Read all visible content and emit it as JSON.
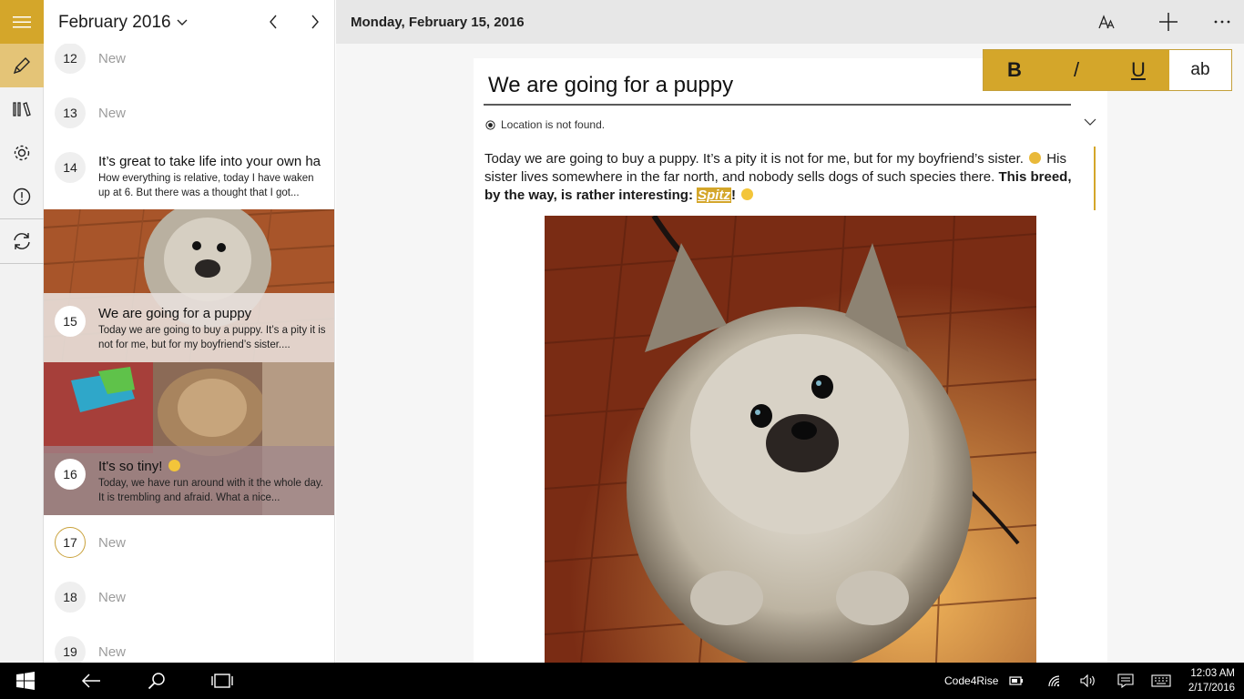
{
  "header": {
    "month": "February 2016",
    "date": "Monday, February 15, 2016"
  },
  "list": {
    "days": [
      {
        "day": "12",
        "label": "New"
      },
      {
        "day": "13",
        "label": "New"
      },
      {
        "day": "14",
        "title": "It’s great to take life into your own ha",
        "body": "How everything is relative, today I have waken up at 6. But there was a thought that I got..."
      },
      {
        "day": "15",
        "title": "We are going for a puppy",
        "body": "Today we are going to buy a puppy. It’s a pity it is not for me, but for my boyfriend’s sister...."
      },
      {
        "day": "16",
        "title": "It's so tiny!",
        "body": "Today, we have run around with it the whole day. It is trembling and afraid. What a nice..."
      },
      {
        "day": "17",
        "label": "New"
      },
      {
        "day": "18",
        "label": "New"
      },
      {
        "day": "19",
        "label": "New"
      }
    ]
  },
  "entry": {
    "title": "We are going for a puppy",
    "location": "Location is not found.",
    "text_1": "Today we are going to buy a puppy. It’s a pity it is not for me, but for my boyfriend’s sister.",
    "text_2": " His sister lives somewhere in the far north, and nobody sells dogs of such species there. ",
    "text_bold": "This breed, by the way, is rather interesting: ",
    "highlight": "Spitz",
    "text_end": "!"
  },
  "format": {
    "bold": "B",
    "italic": "/",
    "underline": "U",
    "style": "ab"
  },
  "taskbar": {
    "app_name": "Code4Rise",
    "time": "12:03 AM",
    "date": "2/17/2016"
  },
  "colors": {
    "accent": "#d4a62a",
    "accent_light": "#e4c477"
  }
}
